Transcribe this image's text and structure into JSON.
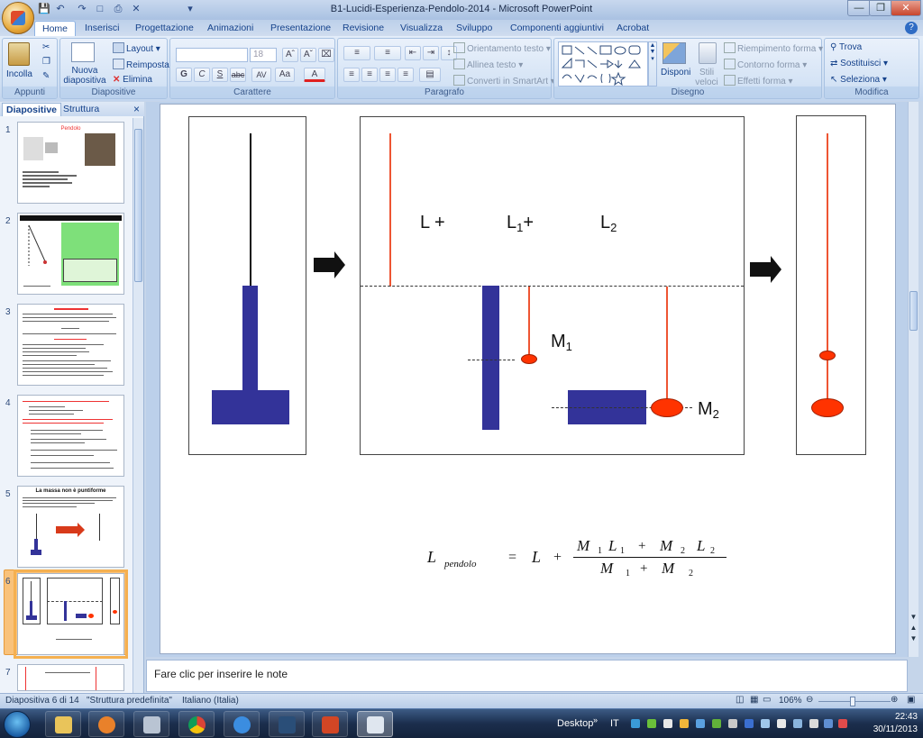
{
  "window": {
    "title": "B1-Lucidi-Esperienza-Pendolo-2014 - Microsoft PowerPoint"
  },
  "ribbon_tabs": [
    "Home",
    "Inserisci",
    "Progettazione",
    "Animazioni",
    "Presentazione",
    "Revisione",
    "Visualizza",
    "Sviluppo",
    "Componenti aggiuntivi",
    "Acrobat"
  ],
  "groups": {
    "appunti": {
      "label": "Appunti",
      "paste": "Incolla"
    },
    "diapositive": {
      "label": "Diapositive",
      "new_slide": "Nuova diapositiva",
      "layout": "Layout",
      "reset": "Reimposta",
      "delete": "Elimina"
    },
    "carattere": {
      "label": "Carattere",
      "font_size": "18",
      "bold": "G",
      "italic": "C",
      "underline": "S",
      "strike": "abc",
      "spacing": "AV",
      "case": "Aa"
    },
    "paragrafo": {
      "label": "Paragrafo",
      "text_direction": "Orientamento testo",
      "align_text": "Allinea testo",
      "smartart": "Converti in SmartArt"
    },
    "disegno": {
      "label": "Disegno",
      "arrange": "Disponi",
      "quick_styles": "Stili veloci",
      "fill": "Riempimento forma",
      "outline": "Contorno forma",
      "effects": "Effetti forma"
    },
    "modifica": {
      "label": "Modifica",
      "find": "Trova",
      "replace": "Sostituisci",
      "select": "Seleziona"
    }
  },
  "panel": {
    "tab_slides": "Diapositive",
    "tab_outline": "Struttura",
    "close": "×"
  },
  "thumbnails": [
    {
      "num": "1",
      "title": "Pendolo"
    },
    {
      "num": "2",
      "title": ""
    },
    {
      "num": "3",
      "title": ""
    },
    {
      "num": "4",
      "title": ""
    },
    {
      "num": "5",
      "title": "La massa non è puntiforme"
    },
    {
      "num": "6",
      "title": ""
    },
    {
      "num": "7",
      "title": ""
    }
  ],
  "slide": {
    "label_L": "L +",
    "label_L1": "L",
    "label_L1_sub": "1",
    "label_L1_plus": "+",
    "label_L2": "L",
    "label_L2_sub": "2",
    "label_M1": "M",
    "label_M1_sub": "1",
    "label_M2": "M",
    "label_M2_sub": "2",
    "formula": {
      "lhs": "L",
      "lhs_sub": "pendolo",
      "eq": "=",
      "L": "L",
      "plus": "+",
      "num_M1": "M",
      "num_1a": "1",
      "num_L1": "L",
      "num_1b": "1",
      "num_plus": "+",
      "num_M2": "M",
      "num_2a": "2",
      "num_L2": "L",
      "num_2b": "2",
      "den_M1": "M",
      "den_1": "1",
      "den_plus": "+",
      "den_M2": "M",
      "den_2": "2"
    }
  },
  "notes": {
    "placeholder": "Fare clic per inserire le note"
  },
  "status": {
    "slide": "Diapositiva 6 di 14",
    "theme": "\"Struttura predefinita\"",
    "language": "Italiano (Italia)",
    "zoom": "106%"
  },
  "taskbar": {
    "desktop": "Desktop",
    "lang": "IT",
    "time": "22:43",
    "date": "30/11/2013"
  },
  "colors": {
    "blue": "#333399",
    "red": "#ff3300",
    "redline": "#ee5533"
  }
}
